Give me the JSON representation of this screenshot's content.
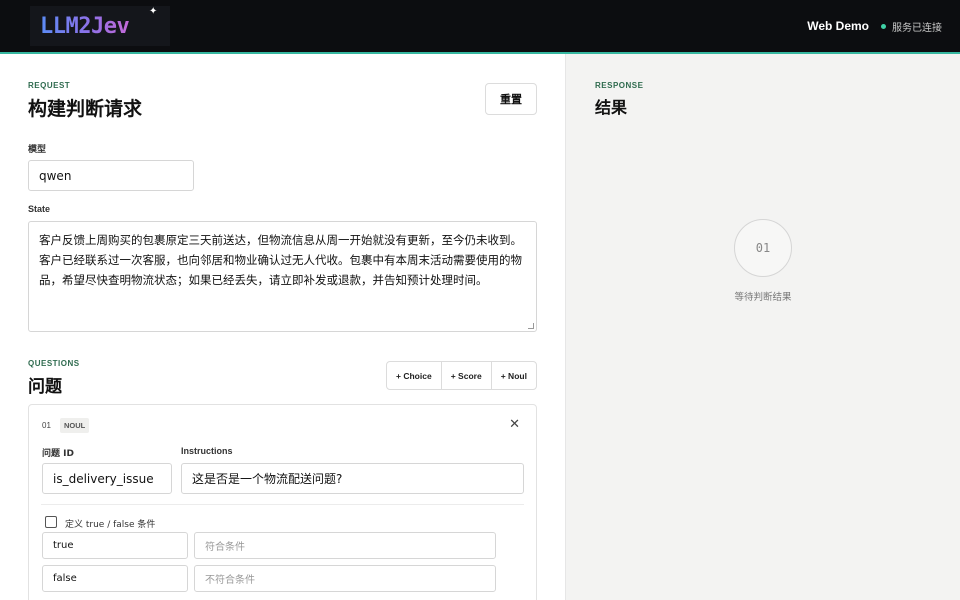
{
  "header": {
    "logo_text": "LLM2Jev",
    "web_demo": "Web Demo",
    "status": "服务已连接",
    "colors": {
      "bg": "#0c0d10",
      "accent_line": "#36b7a0",
      "status_dot": "#3fd1a6"
    }
  },
  "request": {
    "kicker": "REQUEST",
    "title": "构建判断请求",
    "reset_label": "重置",
    "model_label": "模型",
    "model_value": "qwen",
    "state_label": "State",
    "state_value": "客户反馈上周购买的包裹原定三天前送达，但物流信息从周一开始就没有更新，至今仍未收到。客户已经联系过一次客服，也向邻居和物业确认过无人代收。包裹中有本周末活动需要使用的物品，希望尽快查明物流状态；如果已经丢失，请立即补发或退款，并告知预计处理时间。"
  },
  "questions": {
    "kicker": "QUESTIONS",
    "title": "问题",
    "add_buttons": [
      "+ Choice",
      "+ Score",
      "+ Noul"
    ],
    "items": [
      {
        "number": "01",
        "type_badge": "NOUL",
        "id_label": "问题 ID",
        "id_value": "is_delivery_issue",
        "instructions_label": "Instructions",
        "instructions_value": "这是否是一个物流配送问题?",
        "define_condition_label": "定义 true / false 条件",
        "conditions": [
          {
            "key": "true",
            "placeholder": "符合条件"
          },
          {
            "key": "false",
            "placeholder": "不符合条件"
          }
        ]
      }
    ]
  },
  "response": {
    "kicker": "RESPONSE",
    "title": "结果",
    "placeholder_number": "01",
    "waiting_text": "等待判断结果"
  }
}
